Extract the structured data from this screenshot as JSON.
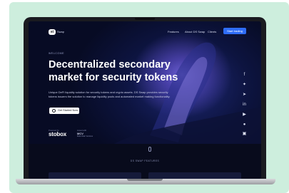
{
  "nav": {
    "logo_mark": "st",
    "logo_text": "Swap",
    "links": [
      "Features",
      "About DS Swap",
      "Clients"
    ],
    "cta_label": "Start trading"
  },
  "hero": {
    "eyebrow": "WELCOME",
    "headline": "Decentralized secondary market for security tokens",
    "description": "Unique DeFi liquidity solution for security tokens and crypto assets. DS Swap provides security tokens issuers the solution to manage liquidity pools and automated market making functionality.",
    "button_label": "Get Started Now"
  },
  "partners": {
    "caption_1": "Powered by",
    "caption_2": "Listed with",
    "stobox": "stobox",
    "mcv": "MCV",
    "mcv_sub": "Multi Chain Ventures"
  },
  "social_icons": [
    "facebook-icon",
    "twitter-icon",
    "telegram-icon",
    "linkedin-icon",
    "youtube-icon",
    "reddit-icon",
    "discord-icon"
  ],
  "section": {
    "title": "DS SWAP FEATURES"
  },
  "colors": {
    "background_card": "#cdeedd",
    "cta": "#2f6df6",
    "screen_dark": "#070b24",
    "accent_purple": "#6a5fd0"
  }
}
